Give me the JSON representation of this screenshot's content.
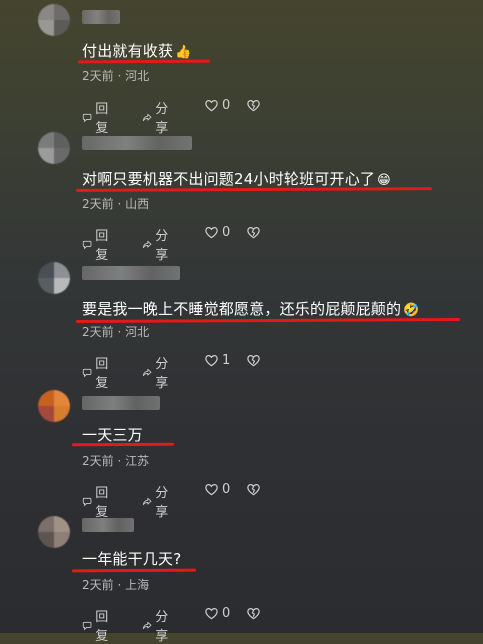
{
  "comments": [
    {
      "text": "付出就有收获",
      "emoji": "👍",
      "meta": "2天前 · 河北",
      "reply_label": "回复",
      "share_label": "分享",
      "like_count": "0",
      "avatar_colors": [
        "#8a8887",
        "#6e6c6a",
        "#9a9895",
        "#5d5b5a"
      ]
    },
    {
      "text": "对啊只要机器不出问题24小时轮班可开心了",
      "emoji": "😁",
      "meta": "2天前 · 山西",
      "reply_label": "回复",
      "share_label": "分享",
      "like_count": "0",
      "avatar_colors": [
        "#7b7b7b",
        "#5f5f5f",
        "#9b9b9b",
        "#6a6a6a"
      ]
    },
    {
      "text": "要是我一晚上不睡觉都愿意，还乐的屁颠屁颠的",
      "emoji": "🤣",
      "meta": "2天前 · 河北",
      "reply_label": "回复",
      "share_label": "分享",
      "like_count": "1",
      "avatar_colors": [
        "#4a4f55",
        "#8c8f93",
        "#595e63",
        "#b7b9bb"
      ]
    },
    {
      "text": "一天三万",
      "emoji": "",
      "meta": "2天前 · 江苏",
      "reply_label": "回复",
      "share_label": "分享",
      "like_count": "0",
      "avatar_colors": [
        "#c6611f",
        "#e3863a",
        "#a4493b",
        "#d77d2e"
      ]
    },
    {
      "text": "一年能干几天?",
      "emoji": "",
      "meta": "2天前 · 上海",
      "reply_label": "回复",
      "share_label": "分享",
      "like_count": "0",
      "avatar_colors": [
        "#7c6f6a",
        "#a09186",
        "#5d5650",
        "#8e8078"
      ]
    }
  ],
  "colors": {
    "underline": "#e41919",
    "text": "#ffffff",
    "meta": "#b9b9b9"
  }
}
